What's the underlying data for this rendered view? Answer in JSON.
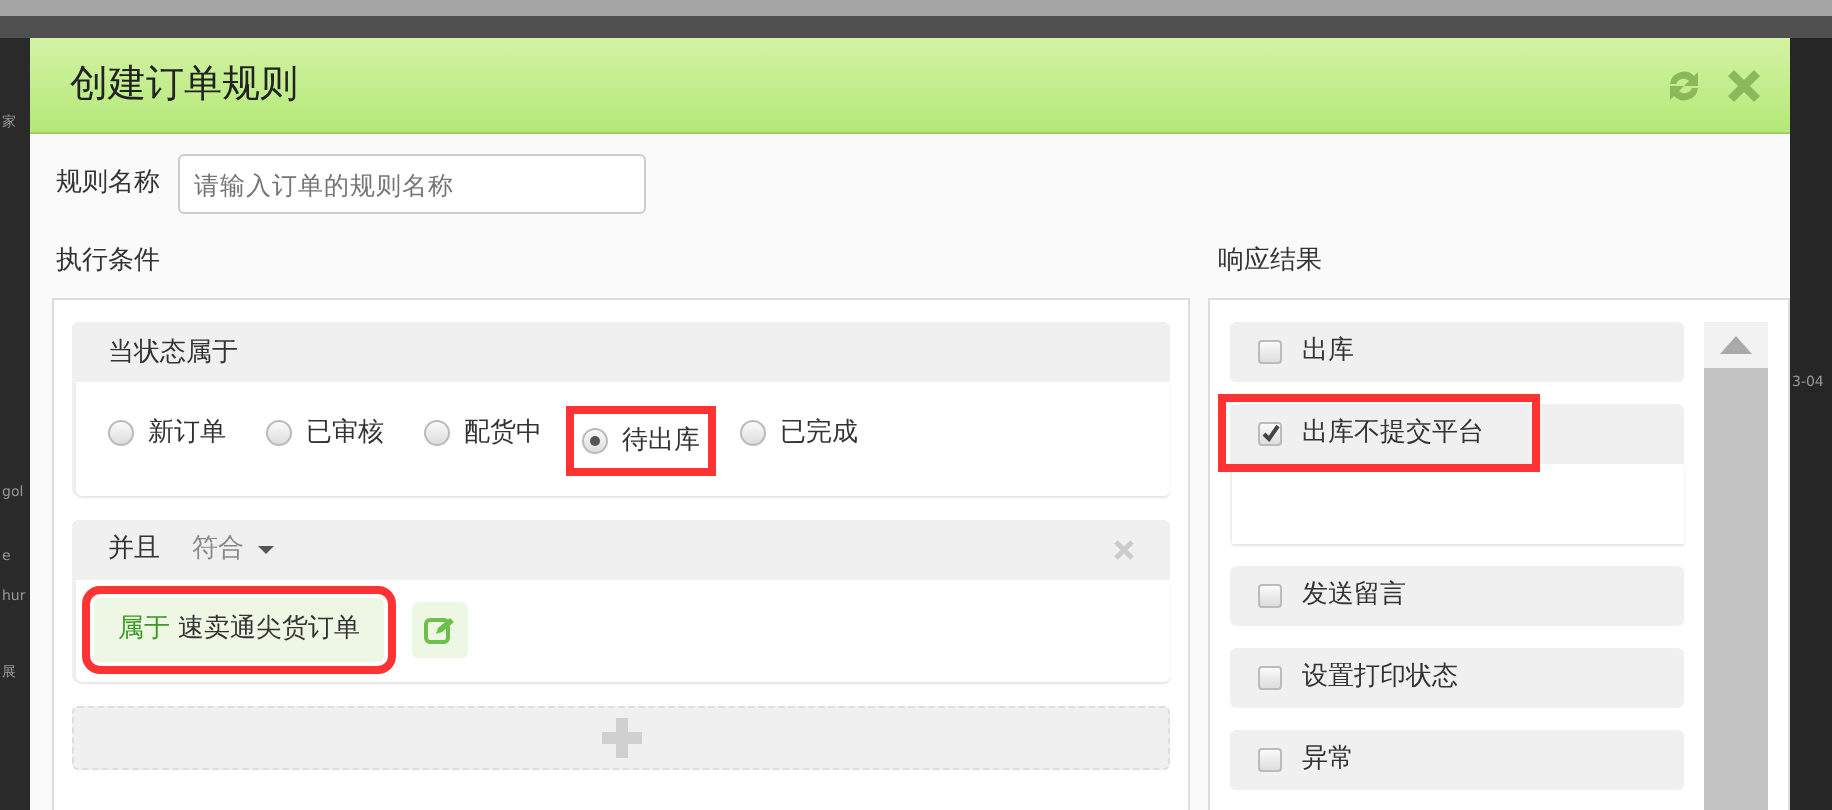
{
  "background_page": {
    "left_fragments": [
      "家",
      "gol",
      "e",
      "hur",
      "展"
    ],
    "right_fragments": [
      "3-04"
    ]
  },
  "dialog": {
    "title": "创建订单规则"
  },
  "rule_name": {
    "label": "规则名称",
    "placeholder": "请输入订单的规则名称"
  },
  "conditions": {
    "heading": "执行条件",
    "status_group": {
      "title": "当状态属于",
      "options": [
        {
          "label": "新订单",
          "selected": false,
          "highlighted": false
        },
        {
          "label": "已审核",
          "selected": false,
          "highlighted": false
        },
        {
          "label": "配货中",
          "selected": false,
          "highlighted": false
        },
        {
          "label": "待出库",
          "selected": true,
          "highlighted": true
        },
        {
          "label": "已完成",
          "selected": false,
          "highlighted": false
        }
      ]
    },
    "and_group": {
      "label": "并且",
      "match_label": "符合",
      "tag": {
        "prefix": "属于",
        "value": "速卖通尖货订单",
        "highlighted": true
      }
    }
  },
  "results": {
    "heading": "响应结果",
    "items": [
      {
        "label": "出库",
        "checked": false,
        "expanded": false,
        "highlighted": false
      },
      {
        "label": "出库不提交平台",
        "checked": true,
        "expanded": true,
        "highlighted": true
      },
      {
        "label": "发送留言",
        "checked": false,
        "expanded": false,
        "highlighted": false
      },
      {
        "label": "设置打印状态",
        "checked": false,
        "expanded": false,
        "highlighted": false
      },
      {
        "label": "异常",
        "checked": false,
        "expanded": false,
        "highlighted": false
      }
    ]
  }
}
